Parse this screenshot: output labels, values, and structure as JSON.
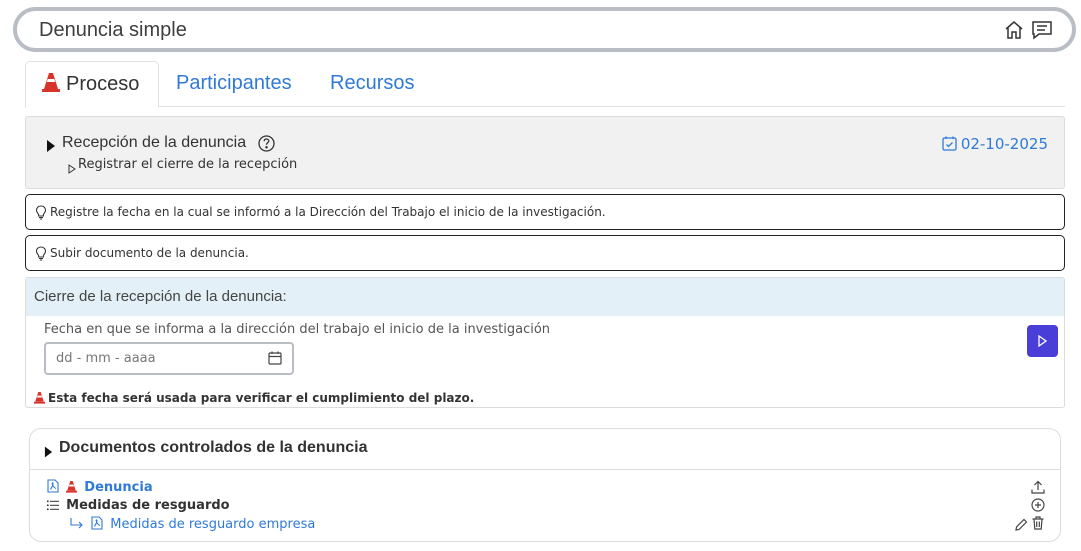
{
  "header": {
    "title": "Denuncia simple",
    "home_icon": "home-icon",
    "chat_icon": "chat-icon"
  },
  "tabs": [
    {
      "label": "Proceso",
      "active": true,
      "icon": "cone-icon"
    },
    {
      "label": "Participantes",
      "active": false
    },
    {
      "label": "Recursos",
      "active": false
    }
  ],
  "step": {
    "title": "Recepción de la denuncia",
    "sub_action": "Registrar el cierre de la recepción",
    "date": "02-10-2025"
  },
  "hints": [
    "Registre la fecha en la cual se informó a la Dirección del Trabajo el inicio de la investigación.",
    "Subir documento de la denuncia."
  ],
  "closure": {
    "title": "Cierre de la recepción de la denuncia:",
    "field_label": "Fecha en que se informa a la dirección del trabajo el inicio de la investigación",
    "placeholder": "dd - mm - aaaa",
    "note": "Esta fecha será usada para verificar el cumplimiento del plazo."
  },
  "documents": {
    "title": "Documentos controlados de la denuncia",
    "items": [
      {
        "label": "Denuncia"
      },
      {
        "label": "Medidas de resguardo"
      },
      {
        "label": "Medidas de resguardo empresa"
      }
    ]
  },
  "colors": {
    "accent": "#2f7ad8",
    "primary_button": "#4a3ed8",
    "warning_cone": "#d9342b"
  }
}
